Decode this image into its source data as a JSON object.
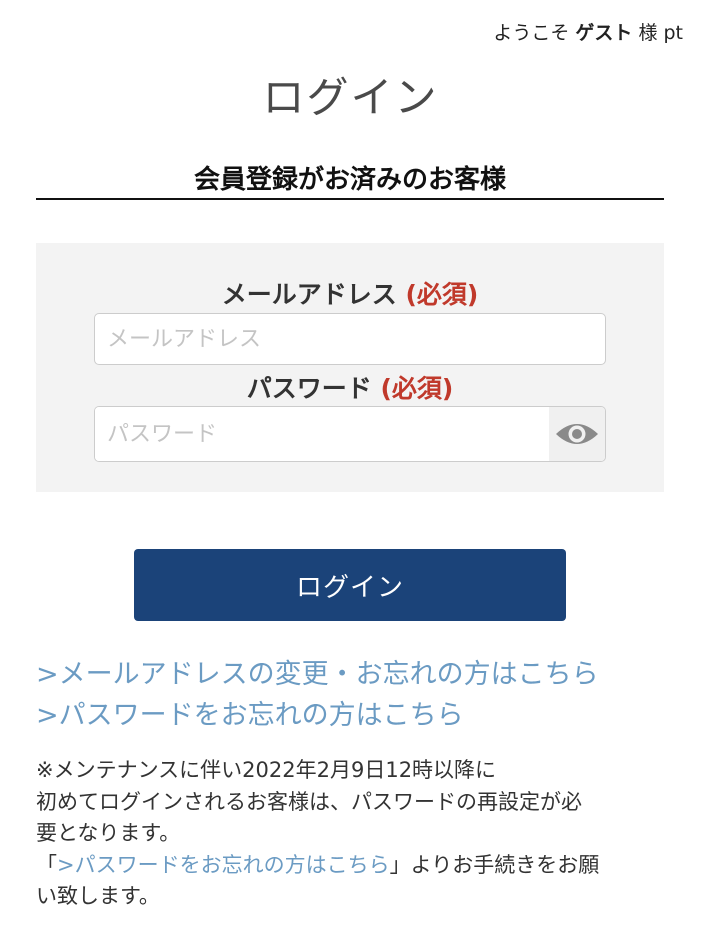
{
  "header": {
    "greeting_prefix": "ようこそ",
    "guest_name": "ゲスト",
    "greeting_suffix": "様 pt"
  },
  "page": {
    "title": "ログイン"
  },
  "login_form": {
    "section_heading": "会員登録がお済みのお客様",
    "email_label": "メールアドレス",
    "email_required": "(必須)",
    "email_placeholder": "メールアドレス",
    "email_value": "",
    "password_label": "パスワード",
    "password_required": "(必須)",
    "password_placeholder": "パスワード",
    "password_value": "",
    "password_toggle_icon": "eye-icon",
    "submit_label": "ログイン"
  },
  "links": {
    "email_change": ">メールアドレスの変更・お忘れの方はこちら",
    "forgot_password": ">パスワードをお忘れの方はこちら"
  },
  "notice": {
    "line1": "※メンテナンスに伴い2022年2月9日12時以降に",
    "line2": "初めてログインされるお客様は、パスワードの再設定が必",
    "line3": "要となります。",
    "line4_open": "「",
    "line4_link": ">パスワードをお忘れの方はこちら",
    "line4_close": "」よりお手続きをお願",
    "line5": "い致します。"
  },
  "colors": {
    "primary_button": "#1b4379",
    "link": "#6b9bc3",
    "required": "#c0392b",
    "panel_background": "#f3f3f3"
  }
}
